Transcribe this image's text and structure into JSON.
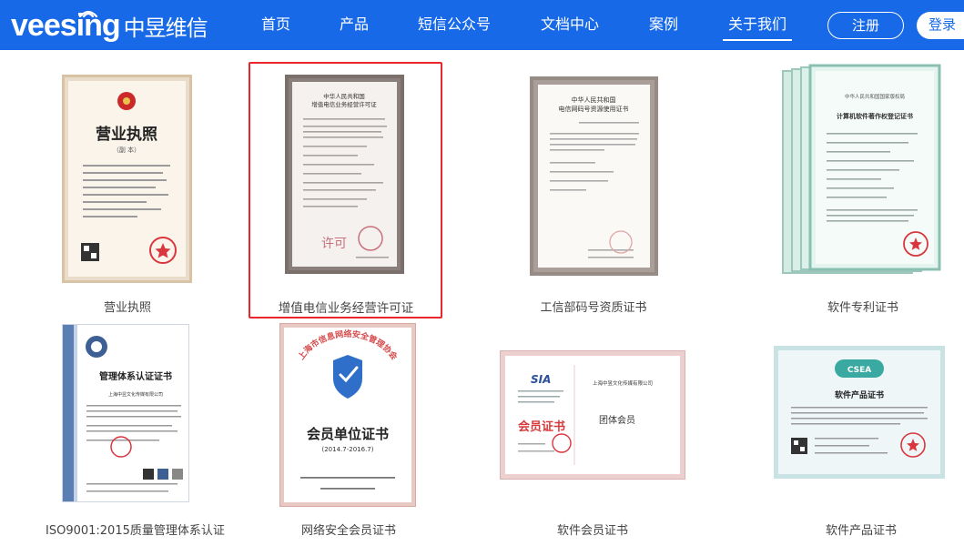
{
  "brand": {
    "logo_latin": "veesing",
    "logo_cn": "中昱维信",
    "primary_color": "#1769e8",
    "highlight_color": "#e8262b"
  },
  "nav": {
    "items": [
      "首页",
      "产品",
      "短信公众号",
      "文档中心",
      "案例",
      "关于我们"
    ],
    "active_label": "关于我们",
    "register_label": "注册",
    "login_label": "登录"
  },
  "certificates": [
    {
      "label": "营业执照",
      "title": "营业执照",
      "subtitle": "（副 本）",
      "selected": false
    },
    {
      "label": "增值电信业务经营许可证",
      "doc_line1": "中华人民共和国",
      "doc_line2": "增值电信业务经营许可证",
      "seal_text": "许可",
      "selected": true
    },
    {
      "label": "工信部码号资质证书",
      "doc_line1": "中华人民共和国",
      "doc_line2": "电信网码号资源使用证书",
      "selected": false
    },
    {
      "label": "软件专利证书",
      "doc_line1": "中华人民共和国国家版权局",
      "doc_line2": "计算机软件著作权登记证书",
      "selected": false
    },
    {
      "label": "ISO9001:2015质量管理体系认证",
      "title": "管理体系认证证书",
      "company": "上海中昱文化传媒有限公司",
      "selected": false
    },
    {
      "label": "网络安全会员证书",
      "title": "会员单位证书",
      "period": "(2014.7-2016.7)",
      "arc_text": "上海市信息网络安全管理协会",
      "selected": false
    },
    {
      "label": "软件会员证书",
      "title": "会员证书",
      "member_type": "团体会员",
      "company": "上海中昱文化传媒有限公司",
      "selected": false
    },
    {
      "label": "软件产品证书",
      "logo_text": "CSEA",
      "title": "软件产品证书",
      "selected": false
    }
  ]
}
